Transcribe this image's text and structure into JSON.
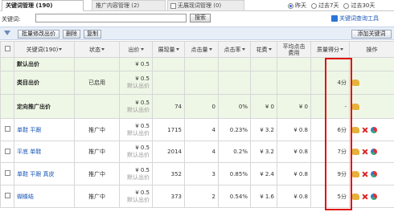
{
  "tabs": [
    {
      "label": "关键词管理",
      "count": "(190)"
    },
    {
      "label": "推广内容管理",
      "count": "(2)"
    },
    {
      "label": "无展现词管理",
      "count": "(0)"
    }
  ],
  "date_range": {
    "options": [
      "昨天",
      "过去7天",
      "过去30天"
    ],
    "selected": "昨天"
  },
  "search": {
    "label": "关键词:",
    "value": "",
    "button": "搜索"
  },
  "tool_link": "关键词查询工具",
  "toolbar": {
    "batch_bid": "批量修改出价",
    "delete": "删除",
    "copy": "复制",
    "add_keyword": "添加关键词"
  },
  "columns": {
    "keyword": "关键词(190)",
    "status": "状态",
    "bid": "出价",
    "impressions": "展现量",
    "clicks": "点击量",
    "ctr": "点击率",
    "cost": "花费",
    "avg_cpc_1": "平均点击",
    "avg_cpc_2": "费用",
    "quality": "质量得分",
    "ops": "操作"
  },
  "default_bid_label": "默认出价",
  "rows": [
    {
      "type": "group",
      "keyword": "默认出价",
      "status": "",
      "bid": "¥ 0.5",
      "bid_note": "",
      "impressions": "",
      "clicks": "",
      "ctr": "",
      "cost": "",
      "avg_cpc": "",
      "quality": ""
    },
    {
      "type": "group",
      "keyword": "类目出价",
      "status": "已启用",
      "bid": "¥ 0.5",
      "bid_note": "默认出价",
      "impressions": "",
      "clicks": "",
      "ctr": "",
      "cost": "",
      "avg_cpc": "",
      "quality": "4分"
    },
    {
      "type": "group",
      "keyword": "定向推广出价",
      "status": "",
      "bid": "¥ 0.5",
      "bid_note": "默认出价",
      "impressions": "74",
      "clicks": "0",
      "ctr": "0%",
      "cost": "¥ 0",
      "avg_cpc": "¥ 0",
      "quality": "-"
    },
    {
      "type": "kw",
      "keyword": "单鞋 平跟",
      "status": "推广中",
      "bid": "¥ 0.5",
      "bid_note": "默认出价",
      "impressions": "1715",
      "clicks": "4",
      "ctr": "0.23%",
      "cost": "¥ 3.2",
      "avg_cpc": "¥ 0.8",
      "quality": "6分"
    },
    {
      "type": "kw",
      "keyword": "平底 单鞋",
      "status": "推广中",
      "bid": "¥ 0.5",
      "bid_note": "默认出价",
      "impressions": "2014",
      "clicks": "4",
      "ctr": "0.2%",
      "cost": "¥ 3.2",
      "avg_cpc": "¥ 0.8",
      "quality": "7分"
    },
    {
      "type": "kw",
      "keyword": "单鞋 平跟 真皮",
      "status": "推广中",
      "bid": "¥ 0.5",
      "bid_note": "默认出价",
      "impressions": "352",
      "clicks": "3",
      "ctr": "0.85%",
      "cost": "¥ 2.4",
      "avg_cpc": "¥ 0.8",
      "quality": "9分"
    },
    {
      "type": "kw",
      "keyword": "蝴蝶结",
      "status": "推广中",
      "bid": "¥ 0.5",
      "bid_note": "默认出价",
      "impressions": "373",
      "clicks": "2",
      "ctr": "0.54%",
      "cost": "¥ 1.6",
      "avg_cpc": "¥ 0.8",
      "quality": "5分"
    }
  ]
}
